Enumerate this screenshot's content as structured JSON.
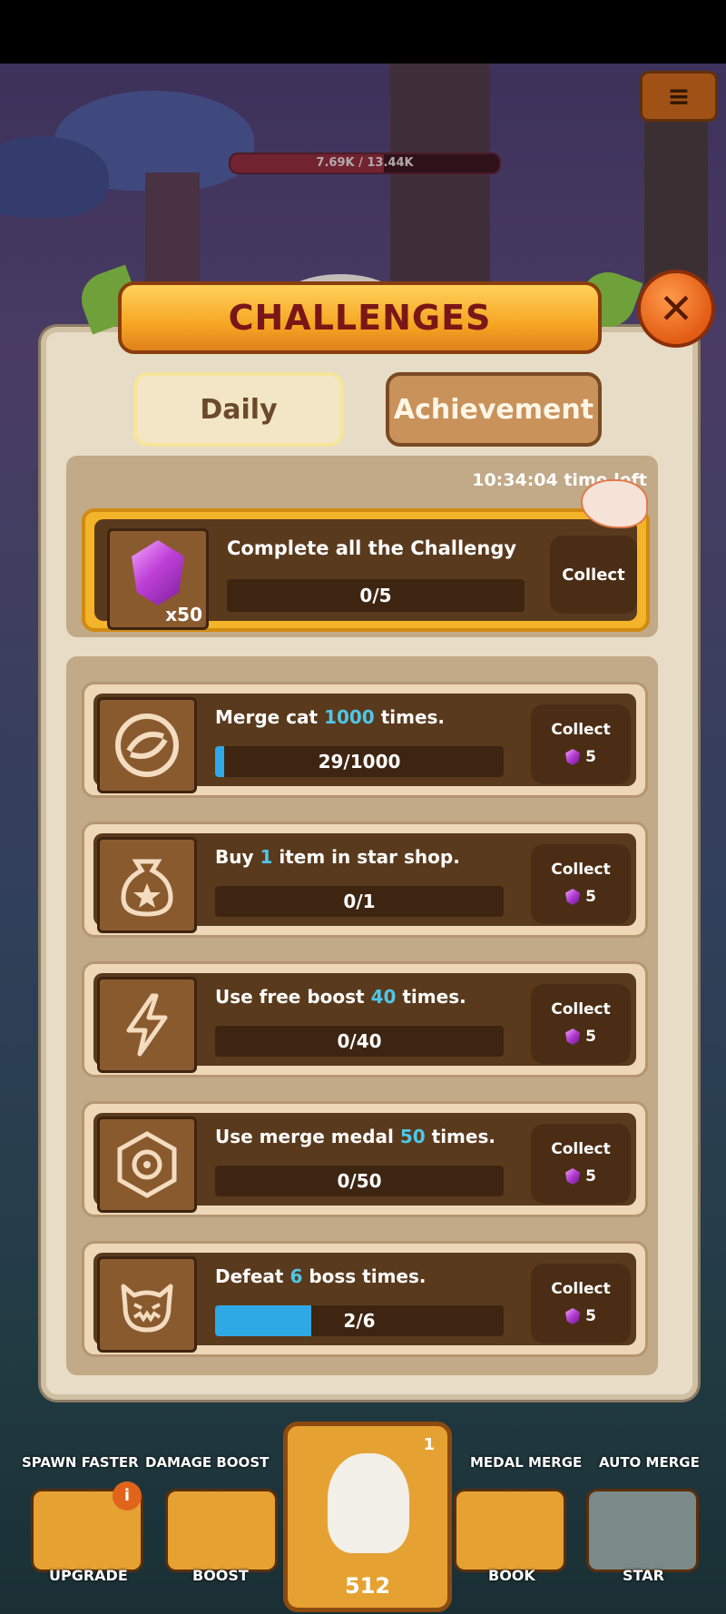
{
  "boss_hp": {
    "text": "7.69K / 13.44K",
    "fraction": 0.572
  },
  "popup": {
    "title": "CHALLENGES",
    "tabs": {
      "daily": "Daily",
      "achievement": "Achievement"
    },
    "time_left": "10:34:04 time left",
    "main_challenge": {
      "title": "Complete all the Challengy",
      "progress_text": "0/5",
      "reward_multiplier": "x50",
      "collect_label": "Collect"
    },
    "tasks": [
      {
        "pre": "Merge cat ",
        "num": "1000",
        "post": " times.",
        "progress_text": "29/1000",
        "progress": 0.029,
        "collect_label": "Collect",
        "reward": "5",
        "icon": "swirl-icon"
      },
      {
        "pre": "Buy ",
        "num": "1",
        "post": " item in star shop.",
        "progress_text": "0/1",
        "progress": 0,
        "collect_label": "Collect",
        "reward": "5",
        "icon": "star-bag-icon"
      },
      {
        "pre": "Use free boost ",
        "num": "40",
        "post": " times.",
        "progress_text": "0/40",
        "progress": 0,
        "collect_label": "Collect",
        "reward": "5",
        "icon": "lightning-icon"
      },
      {
        "pre": "Use merge medal ",
        "num": "50",
        "post": " times.",
        "progress_text": "0/50",
        "progress": 0,
        "collect_label": "Collect",
        "reward": "5",
        "icon": "medal-icon"
      },
      {
        "pre": "Defeat ",
        "num": "6",
        "post": " boss times.",
        "progress_text": "2/6",
        "progress": 0.333,
        "collect_label": "Collect",
        "reward": "5",
        "icon": "boss-face-icon"
      }
    ]
  },
  "bottom_bar": {
    "top_labels": [
      "SPAWN FASTER",
      "DAMAGE BOOST",
      "MEDAL MERGE",
      "AUTO MERGE"
    ],
    "buttons": [
      "UPGRADE",
      "BOOST",
      "BOOK",
      "STAR"
    ],
    "center_count": "1",
    "center_price": "512",
    "upgrade_badge": "i"
  }
}
